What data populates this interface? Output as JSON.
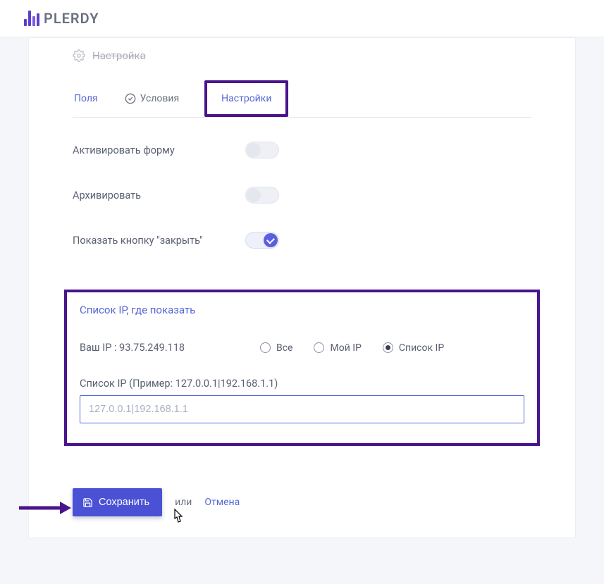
{
  "brand": {
    "name": "PLERDY"
  },
  "header": {
    "title": "Настройка"
  },
  "tabs": {
    "fields": "Поля",
    "conditions": "Условия",
    "settings": "Настройки"
  },
  "toggles": {
    "activate_form": "Активировать форму",
    "archive": "Архивировать",
    "show_close": "Показать кнопку \"закрыть\""
  },
  "ip_panel": {
    "title": "Список IP, где показать",
    "your_ip_label": "Ваш IP : ",
    "your_ip_value": "93.75.249.118",
    "radio_all": "Все",
    "radio_my": "Мой IP",
    "radio_list": "Список IP",
    "list_label": "Список IP (Пример: 127.0.0.1|192.168.1.1)",
    "placeholder": "127.0.0.1|192.168.1.1"
  },
  "footer": {
    "save": "Сохранить",
    "or": "или",
    "cancel": "Отмена"
  }
}
